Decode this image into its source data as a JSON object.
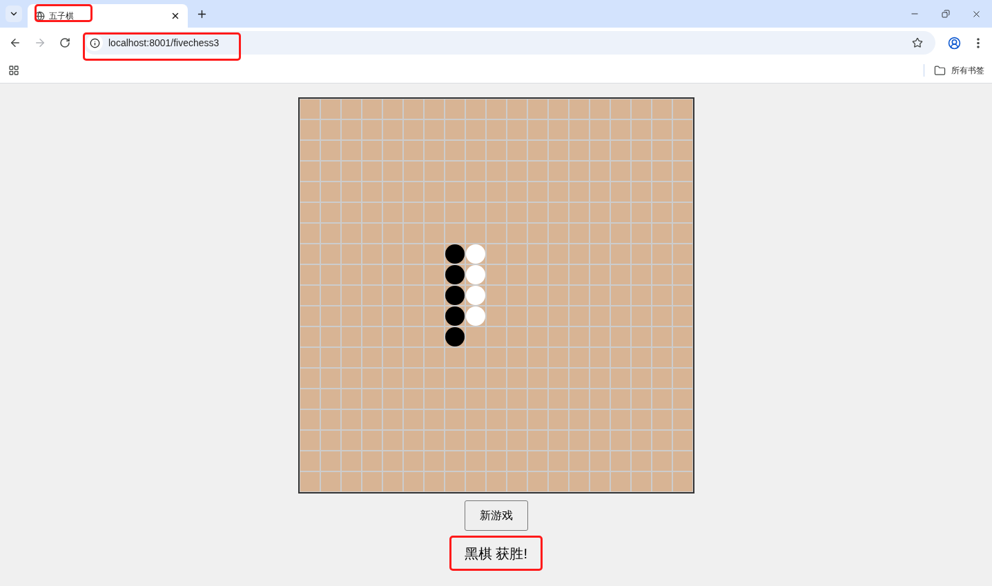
{
  "browser": {
    "tabs": [
      {
        "title": "五子棋",
        "selected": true,
        "highlighted": true
      }
    ],
    "address_bar": {
      "url": "localhost:8001/fivechess3",
      "highlighted": true
    },
    "bookmarks_bar": {
      "items": [
        {
          "label": "所有书签"
        }
      ]
    }
  },
  "board": {
    "rows": [
      [
        {
          "kind": "empty"
        },
        {
          "kind": "empty"
        },
        {
          "kind": "empty"
        },
        {
          "kind": "empty"
        },
        {
          "kind": "empty"
        },
        {
          "kind": "empty"
        },
        {
          "kind": "empty"
        },
        {
          "kind": "empty"
        },
        {
          "kind": "empty"
        },
        {
          "kind": "empty"
        },
        {
          "kind": "empty"
        },
        {
          "kind": "empty"
        },
        {
          "kind": "empty"
        },
        {
          "kind": "empty"
        },
        {
          "kind": "empty"
        },
        {
          "kind": "empty"
        },
        {
          "kind": "empty"
        },
        {
          "kind": "empty"
        },
        {
          "kind": "empty"
        }
      ],
      [
        {
          "kind": "empty"
        },
        {
          "kind": "empty"
        },
        {
          "kind": "empty"
        },
        {
          "kind": "empty"
        },
        {
          "kind": "empty"
        },
        {
          "kind": "empty"
        },
        {
          "kind": "empty"
        },
        {
          "kind": "empty"
        },
        {
          "kind": "empty"
        },
        {
          "kind": "empty"
        },
        {
          "kind": "empty"
        },
        {
          "kind": "empty"
        },
        {
          "kind": "empty"
        },
        {
          "kind": "empty"
        },
        {
          "kind": "empty"
        },
        {
          "kind": "empty"
        },
        {
          "kind": "empty"
        },
        {
          "kind": "empty"
        },
        {
          "kind": "empty"
        }
      ],
      [
        {
          "kind": "empty"
        },
        {
          "kind": "empty"
        },
        {
          "kind": "empty"
        },
        {
          "kind": "empty"
        },
        {
          "kind": "empty"
        },
        {
          "kind": "empty"
        },
        {
          "kind": "empty"
        },
        {
          "kind": "empty"
        },
        {
          "kind": "empty"
        },
        {
          "kind": "empty"
        },
        {
          "kind": "empty"
        },
        {
          "kind": "empty"
        },
        {
          "kind": "empty"
        },
        {
          "kind": "empty"
        },
        {
          "kind": "empty"
        },
        {
          "kind": "empty"
        },
        {
          "kind": "empty"
        },
        {
          "kind": "empty"
        },
        {
          "kind": "empty"
        }
      ],
      [
        {
          "kind": "empty"
        },
        {
          "kind": "empty"
        },
        {
          "kind": "empty"
        },
        {
          "kind": "empty"
        },
        {
          "kind": "empty"
        },
        {
          "kind": "empty"
        },
        {
          "kind": "empty"
        },
        {
          "kind": "empty"
        },
        {
          "kind": "empty"
        },
        {
          "kind": "empty"
        },
        {
          "kind": "empty"
        },
        {
          "kind": "empty"
        },
        {
          "kind": "empty"
        },
        {
          "kind": "empty"
        },
        {
          "kind": "empty"
        },
        {
          "kind": "empty"
        },
        {
          "kind": "empty"
        },
        {
          "kind": "empty"
        },
        {
          "kind": "empty"
        }
      ],
      [
        {
          "kind": "empty"
        },
        {
          "kind": "empty"
        },
        {
          "kind": "empty"
        },
        {
          "kind": "empty"
        },
        {
          "kind": "empty"
        },
        {
          "kind": "empty"
        },
        {
          "kind": "empty"
        },
        {
          "kind": "empty"
        },
        {
          "kind": "empty"
        },
        {
          "kind": "empty"
        },
        {
          "kind": "empty"
        },
        {
          "kind": "empty"
        },
        {
          "kind": "empty"
        },
        {
          "kind": "empty"
        },
        {
          "kind": "empty"
        },
        {
          "kind": "empty"
        },
        {
          "kind": "empty"
        },
        {
          "kind": "empty"
        },
        {
          "kind": "empty"
        }
      ],
      [
        {
          "kind": "empty"
        },
        {
          "kind": "empty"
        },
        {
          "kind": "empty"
        },
        {
          "kind": "empty"
        },
        {
          "kind": "empty"
        },
        {
          "kind": "empty"
        },
        {
          "kind": "empty"
        },
        {
          "kind": "empty"
        },
        {
          "kind": "empty"
        },
        {
          "kind": "empty"
        },
        {
          "kind": "empty"
        },
        {
          "kind": "empty"
        },
        {
          "kind": "empty"
        },
        {
          "kind": "empty"
        },
        {
          "kind": "empty"
        },
        {
          "kind": "empty"
        },
        {
          "kind": "empty"
        },
        {
          "kind": "empty"
        },
        {
          "kind": "empty"
        }
      ],
      [
        {
          "kind": "empty"
        },
        {
          "kind": "empty"
        },
        {
          "kind": "empty"
        },
        {
          "kind": "empty"
        },
        {
          "kind": "empty"
        },
        {
          "kind": "empty"
        },
        {
          "kind": "empty"
        },
        {
          "kind": "empty"
        },
        {
          "kind": "empty"
        },
        {
          "kind": "empty"
        },
        {
          "kind": "empty"
        },
        {
          "kind": "empty"
        },
        {
          "kind": "empty"
        },
        {
          "kind": "empty"
        },
        {
          "kind": "empty"
        },
        {
          "kind": "empty"
        },
        {
          "kind": "empty"
        },
        {
          "kind": "empty"
        },
        {
          "kind": "empty"
        }
      ],
      [
        {
          "kind": "empty"
        },
        {
          "kind": "empty"
        },
        {
          "kind": "empty"
        },
        {
          "kind": "empty"
        },
        {
          "kind": "empty"
        },
        {
          "kind": "empty"
        },
        {
          "kind": "empty"
        },
        {
          "kind": "black"
        },
        {
          "kind": "white"
        },
        {
          "kind": "empty"
        },
        {
          "kind": "empty"
        },
        {
          "kind": "empty"
        },
        {
          "kind": "empty"
        },
        {
          "kind": "empty"
        },
        {
          "kind": "empty"
        },
        {
          "kind": "empty"
        },
        {
          "kind": "empty"
        },
        {
          "kind": "empty"
        },
        {
          "kind": "empty"
        }
      ],
      [
        {
          "kind": "empty"
        },
        {
          "kind": "empty"
        },
        {
          "kind": "empty"
        },
        {
          "kind": "empty"
        },
        {
          "kind": "empty"
        },
        {
          "kind": "empty"
        },
        {
          "kind": "empty"
        },
        {
          "kind": "black"
        },
        {
          "kind": "white"
        },
        {
          "kind": "empty"
        },
        {
          "kind": "empty"
        },
        {
          "kind": "empty"
        },
        {
          "kind": "empty"
        },
        {
          "kind": "empty"
        },
        {
          "kind": "empty"
        },
        {
          "kind": "empty"
        },
        {
          "kind": "empty"
        },
        {
          "kind": "empty"
        },
        {
          "kind": "empty"
        }
      ],
      [
        {
          "kind": "empty"
        },
        {
          "kind": "empty"
        },
        {
          "kind": "empty"
        },
        {
          "kind": "empty"
        },
        {
          "kind": "empty"
        },
        {
          "kind": "empty"
        },
        {
          "kind": "empty"
        },
        {
          "kind": "black"
        },
        {
          "kind": "white"
        },
        {
          "kind": "empty"
        },
        {
          "kind": "empty"
        },
        {
          "kind": "empty"
        },
        {
          "kind": "empty"
        },
        {
          "kind": "empty"
        },
        {
          "kind": "empty"
        },
        {
          "kind": "empty"
        },
        {
          "kind": "empty"
        },
        {
          "kind": "empty"
        },
        {
          "kind": "empty"
        }
      ],
      [
        {
          "kind": "empty"
        },
        {
          "kind": "empty"
        },
        {
          "kind": "empty"
        },
        {
          "kind": "empty"
        },
        {
          "kind": "empty"
        },
        {
          "kind": "empty"
        },
        {
          "kind": "empty"
        },
        {
          "kind": "black"
        },
        {
          "kind": "white"
        },
        {
          "kind": "empty"
        },
        {
          "kind": "empty"
        },
        {
          "kind": "empty"
        },
        {
          "kind": "empty"
        },
        {
          "kind": "empty"
        },
        {
          "kind": "empty"
        },
        {
          "kind": "empty"
        },
        {
          "kind": "empty"
        },
        {
          "kind": "empty"
        },
        {
          "kind": "empty"
        }
      ],
      [
        {
          "kind": "empty"
        },
        {
          "kind": "empty"
        },
        {
          "kind": "empty"
        },
        {
          "kind": "empty"
        },
        {
          "kind": "empty"
        },
        {
          "kind": "empty"
        },
        {
          "kind": "empty"
        },
        {
          "kind": "black"
        },
        {
          "kind": "empty"
        },
        {
          "kind": "empty"
        },
        {
          "kind": "empty"
        },
        {
          "kind": "empty"
        },
        {
          "kind": "empty"
        },
        {
          "kind": "empty"
        },
        {
          "kind": "empty"
        },
        {
          "kind": "empty"
        },
        {
          "kind": "empty"
        },
        {
          "kind": "empty"
        },
        {
          "kind": "empty"
        }
      ],
      [
        {
          "kind": "empty"
        },
        {
          "kind": "empty"
        },
        {
          "kind": "empty"
        },
        {
          "kind": "empty"
        },
        {
          "kind": "empty"
        },
        {
          "kind": "empty"
        },
        {
          "kind": "empty"
        },
        {
          "kind": "empty"
        },
        {
          "kind": "empty"
        },
        {
          "kind": "empty"
        },
        {
          "kind": "empty"
        },
        {
          "kind": "empty"
        },
        {
          "kind": "empty"
        },
        {
          "kind": "empty"
        },
        {
          "kind": "empty"
        },
        {
          "kind": "empty"
        },
        {
          "kind": "empty"
        },
        {
          "kind": "empty"
        },
        {
          "kind": "empty"
        }
      ],
      [
        {
          "kind": "empty"
        },
        {
          "kind": "empty"
        },
        {
          "kind": "empty"
        },
        {
          "kind": "empty"
        },
        {
          "kind": "empty"
        },
        {
          "kind": "empty"
        },
        {
          "kind": "empty"
        },
        {
          "kind": "empty"
        },
        {
          "kind": "empty"
        },
        {
          "kind": "empty"
        },
        {
          "kind": "empty"
        },
        {
          "kind": "empty"
        },
        {
          "kind": "empty"
        },
        {
          "kind": "empty"
        },
        {
          "kind": "empty"
        },
        {
          "kind": "empty"
        },
        {
          "kind": "empty"
        },
        {
          "kind": "empty"
        },
        {
          "kind": "empty"
        }
      ],
      [
        {
          "kind": "empty"
        },
        {
          "kind": "empty"
        },
        {
          "kind": "empty"
        },
        {
          "kind": "empty"
        },
        {
          "kind": "empty"
        },
        {
          "kind": "empty"
        },
        {
          "kind": "empty"
        },
        {
          "kind": "empty"
        },
        {
          "kind": "empty"
        },
        {
          "kind": "empty"
        },
        {
          "kind": "empty"
        },
        {
          "kind": "empty"
        },
        {
          "kind": "empty"
        },
        {
          "kind": "empty"
        },
        {
          "kind": "empty"
        },
        {
          "kind": "empty"
        },
        {
          "kind": "empty"
        },
        {
          "kind": "empty"
        },
        {
          "kind": "empty"
        }
      ],
      [
        {
          "kind": "empty"
        },
        {
          "kind": "empty"
        },
        {
          "kind": "empty"
        },
        {
          "kind": "empty"
        },
        {
          "kind": "empty"
        },
        {
          "kind": "empty"
        },
        {
          "kind": "empty"
        },
        {
          "kind": "empty"
        },
        {
          "kind": "empty"
        },
        {
          "kind": "empty"
        },
        {
          "kind": "empty"
        },
        {
          "kind": "empty"
        },
        {
          "kind": "empty"
        },
        {
          "kind": "empty"
        },
        {
          "kind": "empty"
        },
        {
          "kind": "empty"
        },
        {
          "kind": "empty"
        },
        {
          "kind": "empty"
        },
        {
          "kind": "empty"
        }
      ],
      [
        {
          "kind": "empty"
        },
        {
          "kind": "empty"
        },
        {
          "kind": "empty"
        },
        {
          "kind": "empty"
        },
        {
          "kind": "empty"
        },
        {
          "kind": "empty"
        },
        {
          "kind": "empty"
        },
        {
          "kind": "empty"
        },
        {
          "kind": "empty"
        },
        {
          "kind": "empty"
        },
        {
          "kind": "empty"
        },
        {
          "kind": "empty"
        },
        {
          "kind": "empty"
        },
        {
          "kind": "empty"
        },
        {
          "kind": "empty"
        },
        {
          "kind": "empty"
        },
        {
          "kind": "empty"
        },
        {
          "kind": "empty"
        },
        {
          "kind": "empty"
        }
      ],
      [
        {
          "kind": "empty"
        },
        {
          "kind": "empty"
        },
        {
          "kind": "empty"
        },
        {
          "kind": "empty"
        },
        {
          "kind": "empty"
        },
        {
          "kind": "empty"
        },
        {
          "kind": "empty"
        },
        {
          "kind": "empty"
        },
        {
          "kind": "empty"
        },
        {
          "kind": "empty"
        },
        {
          "kind": "empty"
        },
        {
          "kind": "empty"
        },
        {
          "kind": "empty"
        },
        {
          "kind": "empty"
        },
        {
          "kind": "empty"
        },
        {
          "kind": "empty"
        },
        {
          "kind": "empty"
        },
        {
          "kind": "empty"
        },
        {
          "kind": "empty"
        }
      ],
      [
        {
          "kind": "empty"
        },
        {
          "kind": "empty"
        },
        {
          "kind": "empty"
        },
        {
          "kind": "empty"
        },
        {
          "kind": "empty"
        },
        {
          "kind": "empty"
        },
        {
          "kind": "empty"
        },
        {
          "kind": "empty"
        },
        {
          "kind": "empty"
        },
        {
          "kind": "empty"
        },
        {
          "kind": "empty"
        },
        {
          "kind": "empty"
        },
        {
          "kind": "empty"
        },
        {
          "kind": "empty"
        },
        {
          "kind": "empty"
        },
        {
          "kind": "empty"
        },
        {
          "kind": "empty"
        },
        {
          "kind": "empty"
        },
        {
          "kind": "empty"
        }
      ]
    ]
  },
  "new_game_button": {
    "label": "新游戏"
  },
  "status": {
    "text": "黑棋 获胜!",
    "highlighted": true
  }
}
